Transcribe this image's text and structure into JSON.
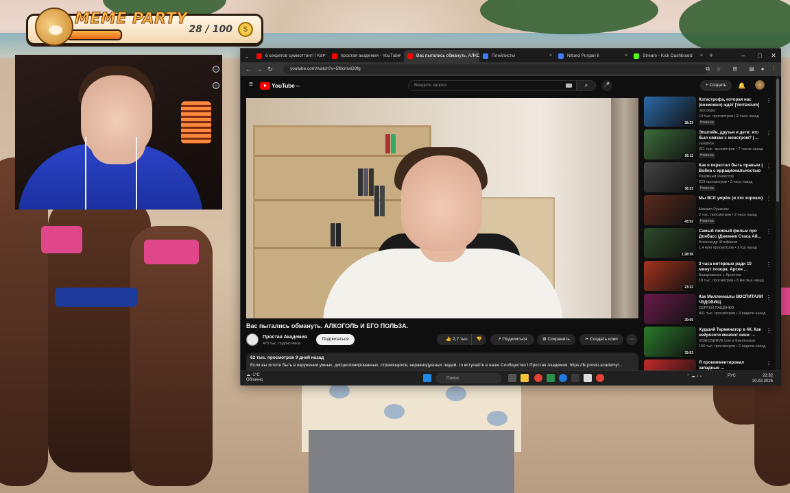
{
  "overlay": {
    "title": "MEME PARTY",
    "counter": "28 / 100",
    "progress": 0.28
  },
  "browser": {
    "tabs": [
      {
        "label": "6 секретов суммоттинг! / Кат",
        "color": "#ff0000",
        "active": false
      },
      {
        "label": "простая академия - YouTube",
        "color": "#ff0000",
        "active": false
      },
      {
        "label": "Вас пытались обмануть. АЛКО",
        "color": "#ff0000",
        "active": true
      },
      {
        "label": "Плейлисты",
        "color": "#3d7cf6",
        "active": false
      },
      {
        "label": "Nitoed Purgarı li",
        "color": "#3d7cf6",
        "active": false
      },
      {
        "label": "Stream - Kick Dashboard",
        "color": "#53fc18",
        "active": false
      }
    ],
    "url": "youtube.com/watch?v=5f8cmwD9fg"
  },
  "youtube": {
    "logo": "YouTube",
    "logo_region": "RU",
    "search_placeholder": "Введите запрос",
    "create_label": "Создать",
    "video_title": "Вас пытались обмануть. АЛКОГОЛЬ И ЕГО ПОЛЬЗА.",
    "channel_name": "Простая Академия",
    "channel_subs": "470 тыс. подписчиков",
    "subscribe_label": "Подписаться",
    "like_count": "2,7 тыс.",
    "share_label": "Поделиться",
    "save_label": "Сохранить",
    "clip_label": "Создать клип",
    "description_meta": "62 тыс. просмотров  9 дней назад",
    "description_text": "Если вы хотите быть в окружении умных, дисциплинированных, стремящихся, неравнодушных людей, то вступайте в наше Сообщество ! Простая Академия: https://lk.prosto.academy/..."
  },
  "recommendations": [
    {
      "title": "Катастрофа, которая нас (возможно) ждёт [Veritasium]",
      "channel": "Vert Dider",
      "stats": "10 тыс. просмотров • 2 часа назад",
      "badge": "Новинка",
      "duration": "28:23",
      "thumb": "#2b6aa8"
    },
    {
      "title": "Эпштейн, друзья и дети: кто был связан с монстром? | ...",
      "channel": "varlamov",
      "stats": "211 тыс. просмотров • 7 часов назад",
      "badge": "Новинка",
      "duration": "26:11",
      "thumb": "#3d6d3a"
    },
    {
      "title": "Как я перестал быть правым | Война с иррациональностью",
      "channel": "Разумный Инвестор",
      "stats": "229 просмотров • 2 часа назад",
      "badge": "Новинка",
      "duration": "38:23",
      "thumb": "#444444"
    },
    {
      "title": "Мы ВСЕ умрём (и это хорошо)",
      "channel": "Михаил Рушенок",
      "stats": "2 тыс. просмотров • 2 часа назад",
      "badge": "Новинка",
      "duration": "43:52",
      "thumb": "#5a2a1c"
    },
    {
      "title": "Самый лживый фильм про Донбасс (Дневник Стаса Ай...",
      "channel": "Александр Штефанов",
      "stats": "1,4 млн просмотров • 1 год назад",
      "badge": "",
      "duration": "1:28:59",
      "thumb": "#2d4a2a"
    },
    {
      "title": "3 часа интервью ради 10 минут позора. Арсен ...",
      "channel": "Базарование с Арсеном",
      "stats": "19 тыс. просмотров • 8 месяца назад",
      "badge": "",
      "duration": "23:22",
      "thumb": "#a3331e"
    },
    {
      "title": "Как Миллениалы ВОСПИТАЛИ ЧУДОВИЩ",
      "channel": "СЕРГЕЙ ПАЩЕНКО",
      "stats": "431 тыс. просмотров • 3 недели назад",
      "badge": "",
      "duration": "29:59",
      "thumb": "#6a1a4a"
    },
    {
      "title": "Худший Терминатор в 4К. Как нейросети меняют кино. ...",
      "channel": "VIDEOSERVE Live в Кинотеатре",
      "stats": "190 тыс. просмотров • 2 недели назад",
      "badge": "",
      "duration": "32:53",
      "thumb": "#2b7a2b"
    },
    {
      "title": "Я прокомментировал западные ...",
      "channel": "",
      "stats": "",
      "badge": "",
      "duration": "",
      "thumb": "#c22a2a"
    }
  ],
  "taskbar": {
    "weather_temp": "-1°C",
    "weather_desc": "Облачно",
    "search_label": "Поиск",
    "lang": "РУС",
    "time": "22:32",
    "date": "20.02.2025"
  }
}
